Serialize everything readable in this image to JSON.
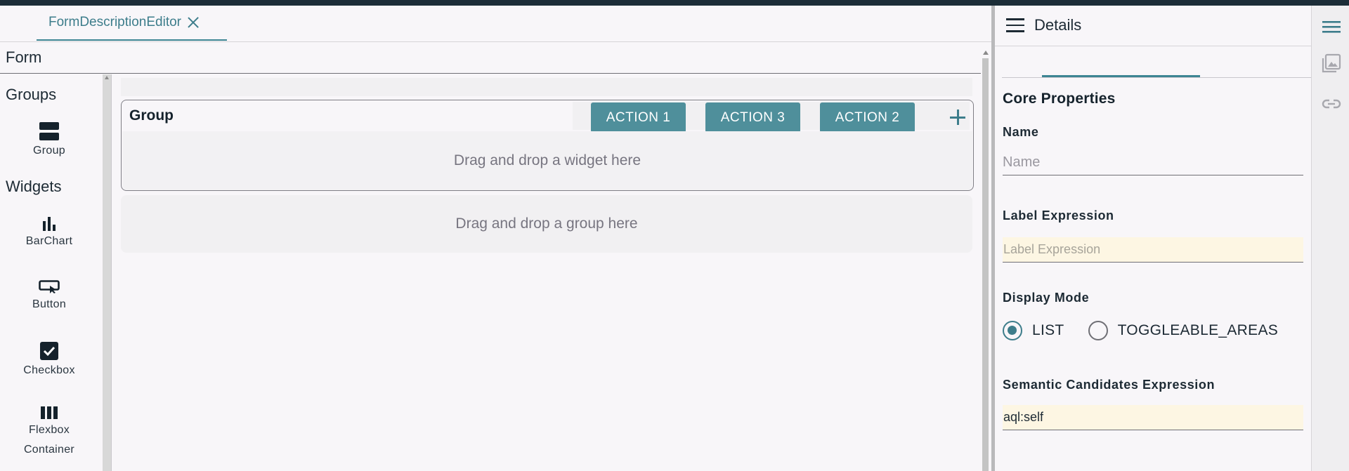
{
  "editor": {
    "tab_label": "FormDescriptionEditor",
    "form_header": "Form"
  },
  "palette": {
    "groups_heading": "Groups",
    "group_item": "Group",
    "widgets_heading": "Widgets",
    "widgets": {
      "barchart": "BarChart",
      "button": "Button",
      "checkbox": "Checkbox",
      "flexbox_line1": "Flexbox",
      "flexbox_line2": "Container"
    }
  },
  "canvas": {
    "group_title": "Group",
    "actions": [
      "ACTION 1",
      "ACTION 3",
      "ACTION 2"
    ],
    "widget_drop": "Drag and drop a widget here",
    "group_drop": "Drag and drop a group here"
  },
  "details": {
    "title": "Details",
    "section_title": "Core Properties",
    "name_label": "Name",
    "name_placeholder": "Name",
    "name_value": "",
    "label_expr_label": "Label Expression",
    "label_expr_placeholder": "Label Expression",
    "label_expr_value": "",
    "display_mode_label": "Display Mode",
    "display_mode_options": [
      "LIST",
      "TOGGLEABLE_AREAS"
    ],
    "display_mode_selected": "LIST",
    "semantic_label": "Semantic Candidates Expression",
    "semantic_value": "aql:self"
  },
  "rail": {
    "icons": [
      "menu-icon",
      "image-icon",
      "link-icon"
    ]
  },
  "colors": {
    "accent": "#3d8593",
    "action_button": "#4f8f9b",
    "expression_field": "#fdf6e3",
    "topbar": "#1c2d38"
  }
}
